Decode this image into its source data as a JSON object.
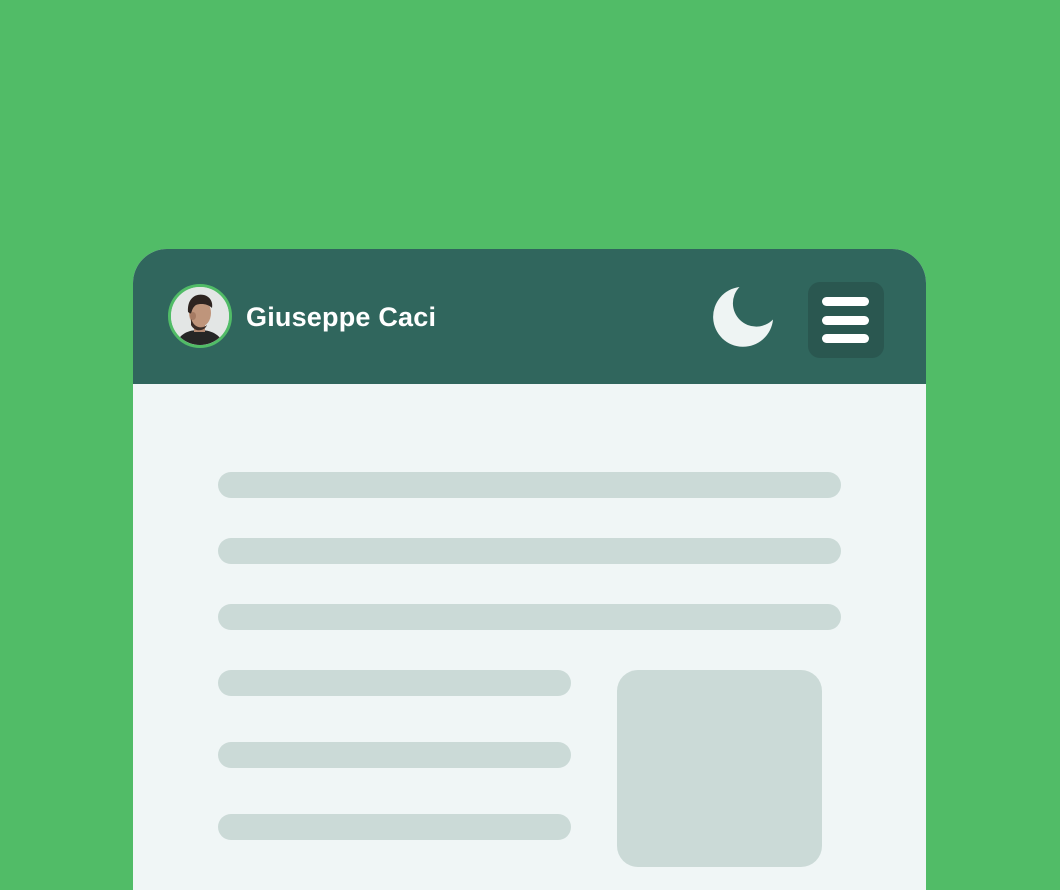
{
  "header": {
    "user_name": "Giuseppe Caci",
    "avatar_icon": "user-photo",
    "theme_toggle_icon": "moon-icon",
    "menu_icon": "hamburger-menu-icon"
  },
  "colors": {
    "page_background": "#51bc67",
    "header_background": "#30665d",
    "menu_button_background": "#2a5750",
    "content_background": "#f0f6f6",
    "placeholder": "#cbdad7",
    "avatar_ring": "#51bc67"
  }
}
